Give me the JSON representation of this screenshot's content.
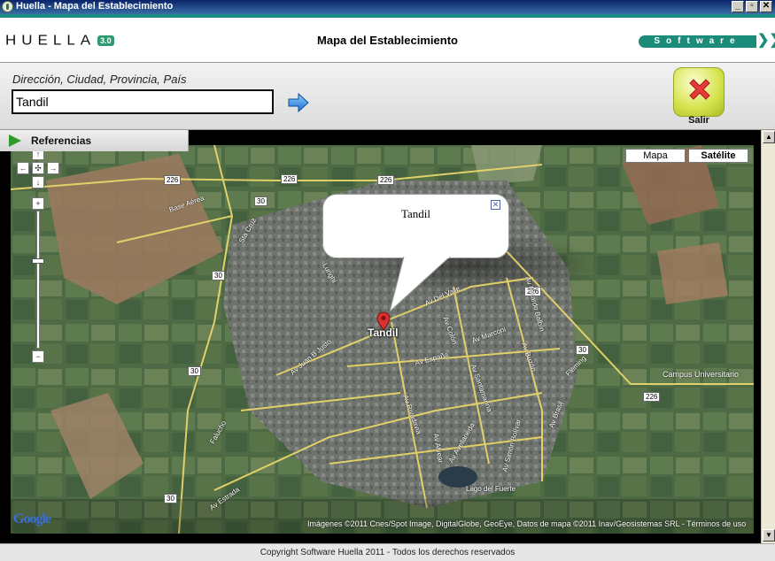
{
  "window": {
    "title": "Huella - Mapa del Establecimiento",
    "minimize_glyph": "_",
    "maximize_glyph": "▫",
    "close_glyph": "✕"
  },
  "header": {
    "logo_word": "HUELLA",
    "logo_version": "3.0",
    "title": "Mapa del Establecimiento",
    "software_badge": "Software",
    "chevrons": "❯❯"
  },
  "search": {
    "label": "Dirección, Ciudad, Provincia, País",
    "value": "Tandil",
    "go_icon": "arrow-right-icon"
  },
  "exit": {
    "label": "Salir",
    "icon": "close-x-icon"
  },
  "references": {
    "label": "Referencias",
    "icon": "play-triangle-icon"
  },
  "map": {
    "map_type_buttons": [
      {
        "label": "Mapa",
        "active": false
      },
      {
        "label": "Satélite",
        "active": true
      }
    ],
    "nav": {
      "up": "↑",
      "left": "←",
      "center": "✣",
      "right": "→",
      "down": "↓",
      "zoom_in": "+",
      "zoom_out": "−"
    },
    "info_window": {
      "title": "Tandil",
      "close": "✕"
    },
    "marker_label": "Tandil",
    "place_labels": [
      "Campus Universitario",
      "Lago del Fuerte"
    ],
    "road_labels": [
      "Base Aérea",
      "Sta Cruz",
      "Lunghi",
      "Av Del Valle",
      "Av Colón",
      "Av Marconi",
      "Av España",
      "Av Juan B Justo",
      "Av Santamarina",
      "Av Rivadavia",
      "Av Avellaneda",
      "Av Estrada",
      "Av Brasil",
      "Fleming",
      "Av Buzón",
      "Av Ricardo Balbín",
      "Av Simón Bolívar",
      "Av Alvear",
      "Falucho"
    ],
    "route_shields": [
      "226",
      "226",
      "226",
      "226",
      "226",
      "30",
      "30",
      "30",
      "30",
      "30"
    ],
    "google_logo": "Google",
    "attribution": "Imágenes ©2011 Cnes/Spot Image, DigitalGlobe, GeoEye, Datos de mapa ©2011 Inav/Geosistemas SRL -",
    "terms_link": "Términos de uso"
  },
  "footer": {
    "copyright": "Copyright Software Huella 2011 - Todos los derechos reservados"
  },
  "colors": {
    "brand_teal": "#1b8c7a",
    "titlebar_start": "#0a246a",
    "titlebar_end": "#3a6ea5",
    "exit_button": "#d4e24a",
    "marker": "#d93030"
  }
}
